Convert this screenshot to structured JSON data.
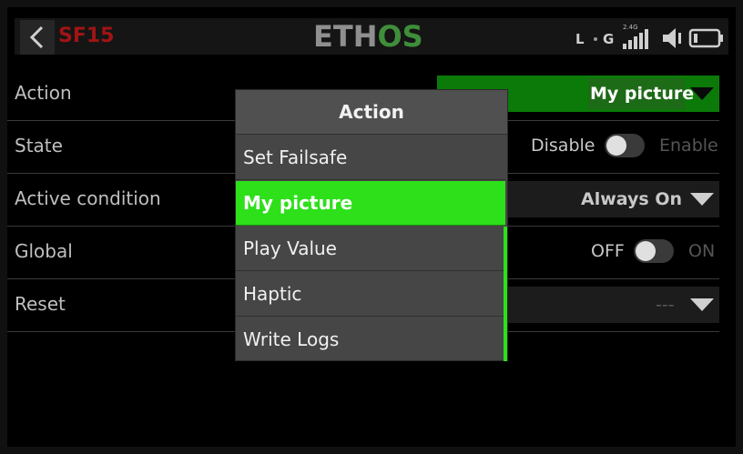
{
  "header": {
    "page_id": "SF15",
    "logo": {
      "part1": "ETH",
      "part2": "OS"
    },
    "status": {
      "telemetry_l": "L",
      "telemetry_g": "G",
      "band": "2.4G",
      "signal_bars": 5
    }
  },
  "rows": [
    {
      "label": "Action",
      "value": "My picture"
    },
    {
      "label": "State",
      "off_label": "Disable",
      "on_label": "Enable",
      "is_on": false
    },
    {
      "label": "Active condition",
      "value": "Always On"
    },
    {
      "label": "Global",
      "off_label": "OFF",
      "on_label": "ON",
      "is_on": false
    },
    {
      "label": "Reset",
      "value": "---"
    }
  ],
  "modal": {
    "title": "Action",
    "options": [
      "Set Failsafe",
      "My picture",
      "Play Value",
      "Haptic",
      "Write Logs"
    ],
    "selected_index": 1
  },
  "colors": {
    "accent": "#2de01a",
    "action_field": "#0b7a08",
    "page_id": "#a01414",
    "logo_os": "#3e8e3a"
  },
  "icons": [
    "chevron-left-icon",
    "signal-bars-icon",
    "speaker-icon",
    "battery-icon",
    "triangle-down-icon"
  ]
}
